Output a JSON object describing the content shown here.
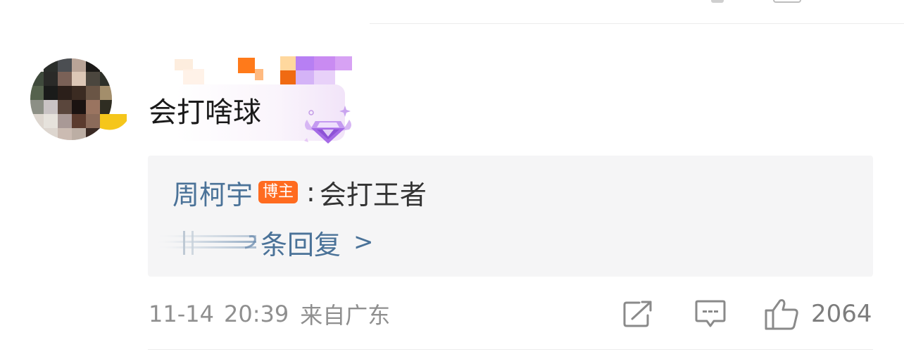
{
  "comment": {
    "text": "会打啥球",
    "time": {
      "date": "11-14",
      "clock": "20:39",
      "location": "来自广东"
    },
    "likes": "2064"
  },
  "reply_preview": {
    "author": "周柯宇",
    "owner_badge": "博主",
    "separator": ":",
    "content": "会打王者",
    "more_label": "条回复",
    "more_arrow": ">"
  },
  "icons": {
    "share": "share-icon",
    "comment": "comment-icon",
    "like": "thumbs-up-icon",
    "badge": "gem-badge-icon"
  },
  "colors": {
    "link": "#4a7298",
    "owner_badge": "#ff6b1f",
    "muted": "#8f8f8f",
    "reply_bg": "#f5f5f6"
  }
}
